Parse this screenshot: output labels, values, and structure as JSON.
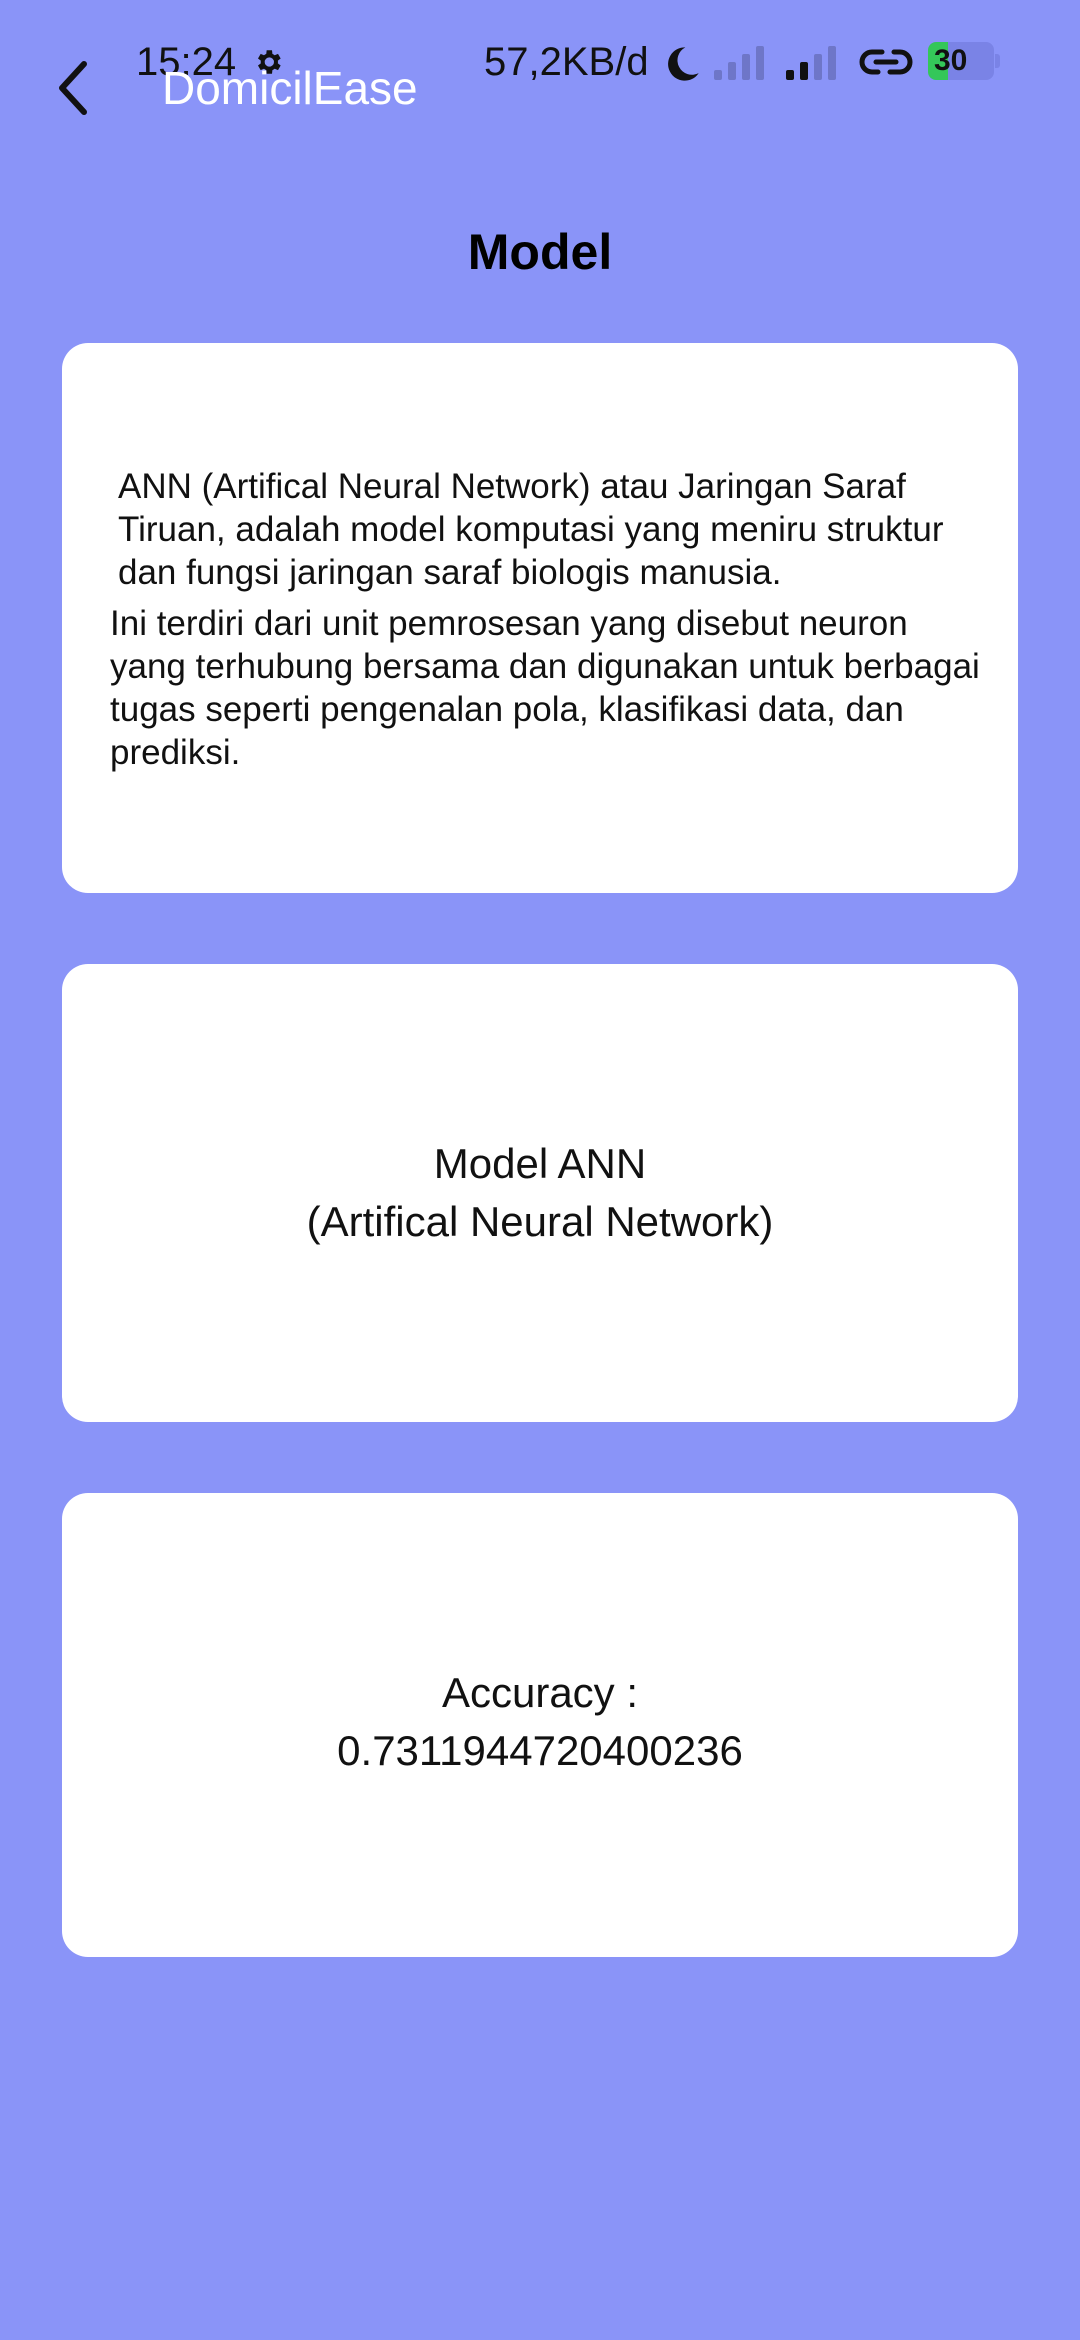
{
  "status_bar": {
    "time": "15:24",
    "net_speed": "57,2KB/d",
    "battery_level": "30",
    "battery_percent": 30,
    "icons": [
      "settings-icon",
      "moon-icon",
      "signal-icon",
      "signal-icon",
      "link-icon",
      "battery-charging-icon"
    ]
  },
  "app_bar": {
    "title": "DomicilEase",
    "back_icon": "chevron-left-icon"
  },
  "page": {
    "title": "Model"
  },
  "description_card": {
    "paragraph1": "ANN (Artifical Neural Network) atau Jaringan Saraf Tiruan, adalah model komputasi yang meniru struktur dan fungsi jaringan saraf biologis manusia.",
    "paragraph2": "Ini terdiri dari unit pemrosesan yang disebut neuron yang terhubung bersama dan digunakan untuk berbagai tugas seperti pengenalan pola, klasifikasi data, dan prediksi."
  },
  "model_card": {
    "line1": "Model ANN",
    "line2": "(Artifical Neural Network)"
  },
  "accuracy_card": {
    "label": "Accuracy :",
    "value": "0.7311944720400236"
  },
  "colors": {
    "background": "#8a94f8",
    "card": "#ffffff",
    "battery_fill": "#34c759",
    "app_title": "#ffffff"
  }
}
